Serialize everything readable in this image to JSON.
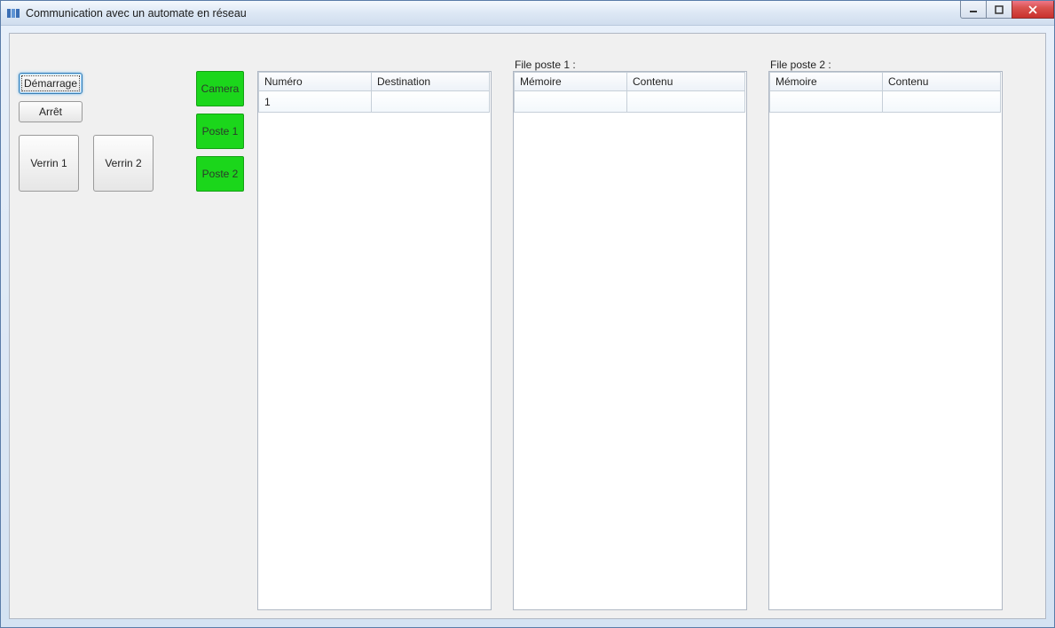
{
  "window": {
    "title": "Communication avec un automate en réseau"
  },
  "controls": {
    "start_label": "Démarrage",
    "stop_label": "Arrêt",
    "verrin1_label": "Verrin 1",
    "verrin2_label": "Verrin 2"
  },
  "indicators": {
    "camera_label": "Camera",
    "poste1_label": "Poste 1",
    "poste2_label": "Poste 2",
    "active_color": "#1bd61b"
  },
  "panels": {
    "main": {
      "columns": {
        "numero": "Numéro",
        "destination": "Destination"
      },
      "rows": [
        {
          "numero": "1",
          "destination": ""
        }
      ]
    },
    "file1": {
      "title": "File poste 1 :",
      "columns": {
        "memoire": "Mémoire",
        "contenu": "Contenu"
      },
      "rows": [
        {
          "memoire": "",
          "contenu": ""
        }
      ]
    },
    "file2": {
      "title": "File poste 2 :",
      "columns": {
        "memoire": "Mémoire",
        "contenu": "Contenu"
      },
      "rows": [
        {
          "memoire": "",
          "contenu": ""
        }
      ]
    }
  }
}
